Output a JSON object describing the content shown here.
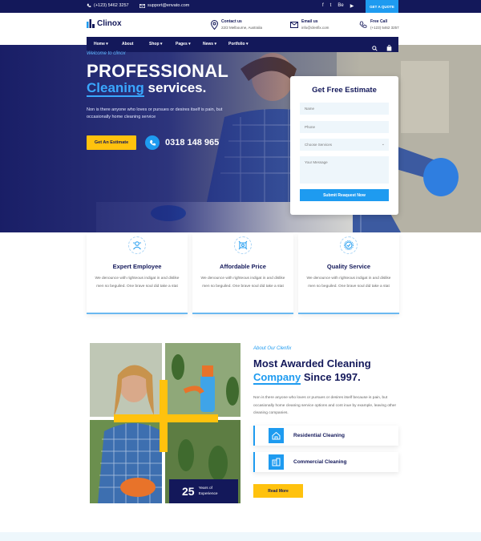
{
  "topbar": {
    "phone": "(+123) 5462 3257",
    "email": "support@envato.com",
    "socials": [
      "f",
      "t",
      "Be",
      "▶"
    ],
    "quote_label": "GET A QUOTE"
  },
  "header": {
    "logo": "Clinox",
    "contacts": [
      {
        "title": "Contact us",
        "detail": "22/2 Melbourne, Australia",
        "icon": "location-pin-icon"
      },
      {
        "title": "Email us",
        "detail": "info@clenfix.com",
        "icon": "email-icon"
      },
      {
        "title": "Free Call",
        "detail": "(+123) 5462 3257",
        "icon": "phone-icon"
      }
    ]
  },
  "nav": {
    "items": [
      "Home",
      "About",
      "Shop",
      "Pages",
      "News",
      "Portfolio"
    ],
    "dropdown_marker": "▾"
  },
  "hero": {
    "welcome": "Welcome to clinox",
    "title_line1": "PROFESSIONAL",
    "title_accent": "Cleaning",
    "title_rest": "services.",
    "text": "Non is there anyone who loves or pursues or desires itself is pain, but occasionally home cleaning service",
    "button": "Get An Estimate",
    "phone": "0318 148 965"
  },
  "form": {
    "title": "Get Free Estimate",
    "name_placeholder": "Name",
    "phone_placeholder": "Phone",
    "service_placeholder": "Choose Services",
    "message_placeholder": "Your Message",
    "submit": "Submit Reaquest Now"
  },
  "features": [
    {
      "title": "Expert Employee",
      "desc": "We denounce with righteous indigat in and dislike men so beguiled. One brave soul did take a stat",
      "icon": "employee-icon"
    },
    {
      "title": "Affordable Price",
      "desc": "We denounce with righteous indigat in and dislike men so beguiled. One brave soul did take a stat",
      "icon": "price-icon"
    },
    {
      "title": "Quality Service",
      "desc": "We denounce with righteous indigat in and dislike men so beguiled. One brave soul did take a stat",
      "icon": "quality-icon"
    }
  ],
  "about": {
    "subtitle": "About Our Clenfix",
    "title_line1": "Most Awarded Cleaning",
    "title_accent": "Company",
    "title_rest": "Since 1997.",
    "text": "Non is there anyone who loves or pursues or desires itself because is pain, but occasionally home cleaning service options and cont inue by example, leaving other cleaning companies.",
    "services": [
      {
        "label": "Residential Cleaning",
        "icon": "residential-icon"
      },
      {
        "label": "Commercial Cleaning",
        "icon": "commercial-icon"
      }
    ],
    "button": "Read More",
    "exp_number": "25",
    "exp_label_1": "Years of",
    "exp_label_2": "Experience"
  },
  "colors": {
    "navy": "#13185a",
    "blue": "#1e9bf0",
    "yellow": "#ffc20e"
  }
}
